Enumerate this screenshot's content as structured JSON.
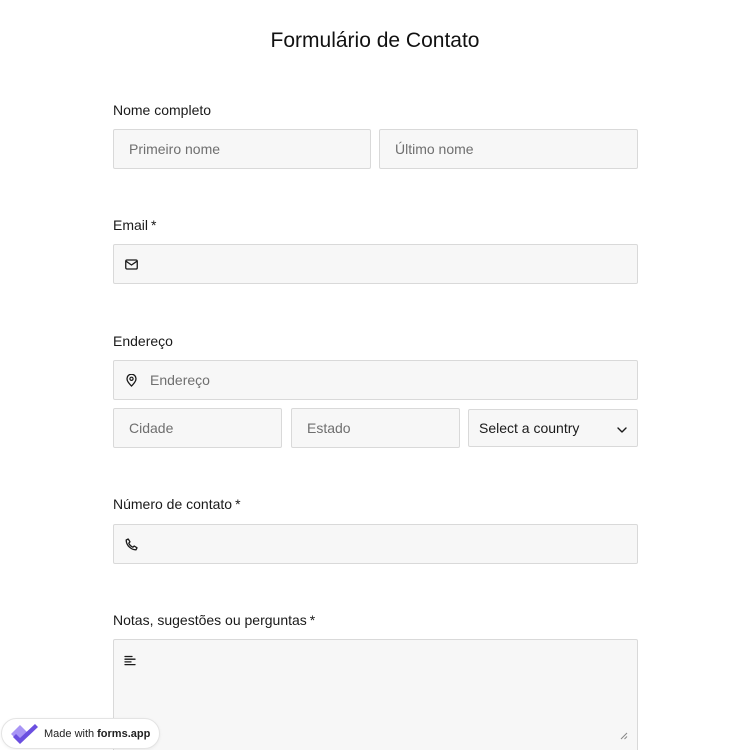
{
  "form": {
    "title": "Formulário de Contato",
    "full_name": {
      "label": "Nome completo",
      "first_placeholder": "Primeiro nome",
      "last_placeholder": "Último nome"
    },
    "email": {
      "label": "Email",
      "required_mark": "*",
      "icon": "envelope-icon"
    },
    "address": {
      "label": "Endereço",
      "street_placeholder": "Endereço",
      "street_icon": "map-pin-icon",
      "city_placeholder": "Cidade",
      "state_placeholder": "Estado",
      "country_selected": "Select a country"
    },
    "phone": {
      "label": "Número de contato",
      "required_mark": "*",
      "icon": "phone-icon"
    },
    "notes": {
      "label": "Notas, sugestões ou perguntas",
      "required_mark": "*",
      "icon": "text-align-left-icon"
    }
  },
  "badge": {
    "prefix": "Made with",
    "brand": "forms.app"
  },
  "colors": {
    "field_bg": "#f7f7f7",
    "field_border": "#d9d9d9",
    "logo_purple": "#6b4fe0",
    "logo_light": "#a995f5"
  }
}
